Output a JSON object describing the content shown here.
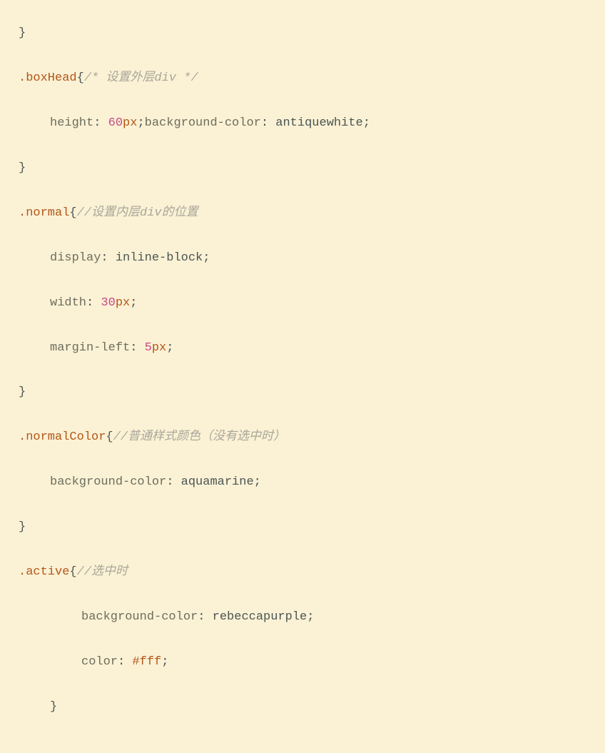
{
  "code": {
    "l0_brace": "}",
    "sel_boxHead": ".boxHead",
    "cmt_boxHead": "/* 设置外层div */",
    "p_height": "height",
    "v_60": "60",
    "u_px": "px",
    "p_bgcolor": "background-color",
    "v_antiquewhite": "antiquewhite",
    "brace_open": "{",
    "brace_close": "}",
    "semi": ";",
    "colon": ":",
    "sp": " ",
    "sel_normal": ".normal",
    "cmt_normal": "//设置内层div的位置",
    "p_display": "display",
    "v_inlineblock": "inline-block",
    "p_width": "width",
    "v_30": "30",
    "p_marginleft": "margin-left",
    "v_5": "5",
    "sel_normalColor": ".normalColor",
    "cmt_normalColor": "//普通样式颜色（没有选中时）",
    "v_aquamarine": "aquamarine",
    "sel_active": ".active",
    "cmt_active": "//选中时",
    "v_rebecca": "rebeccapurple",
    "p_color": "color",
    "v_fff": "#fff"
  }
}
